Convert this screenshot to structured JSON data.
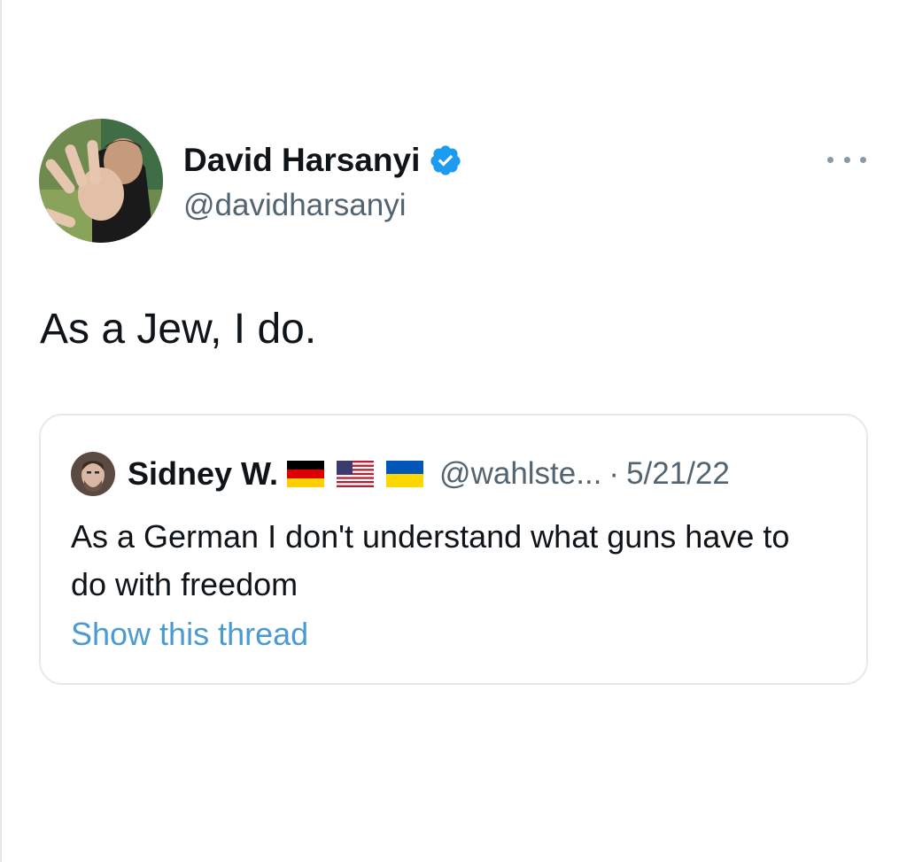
{
  "tweet": {
    "author": {
      "name": "David Harsanyi",
      "handle": "@davidharsanyi",
      "verified": true,
      "avatar_icon": "avatar-photo-icon"
    },
    "more_icon": "more-dots-icon",
    "text": "As a Jew, I do."
  },
  "quoted_tweet": {
    "author": {
      "name": "Sidney W.",
      "flags": [
        "germany-flag-icon",
        "usa-flag-icon",
        "ukraine-flag-icon"
      ],
      "handle": "@wahlste...",
      "separator": "·",
      "date": "5/21/22"
    },
    "text": "As a German I don't understand what guns have to do with freedom",
    "show_thread_label": "Show this thread"
  },
  "colors": {
    "text_primary": "#0f1419",
    "text_secondary": "#536471",
    "link": "#4b9bd0",
    "verified": "#1d9bf0",
    "card_border": "#e6e9ec"
  }
}
